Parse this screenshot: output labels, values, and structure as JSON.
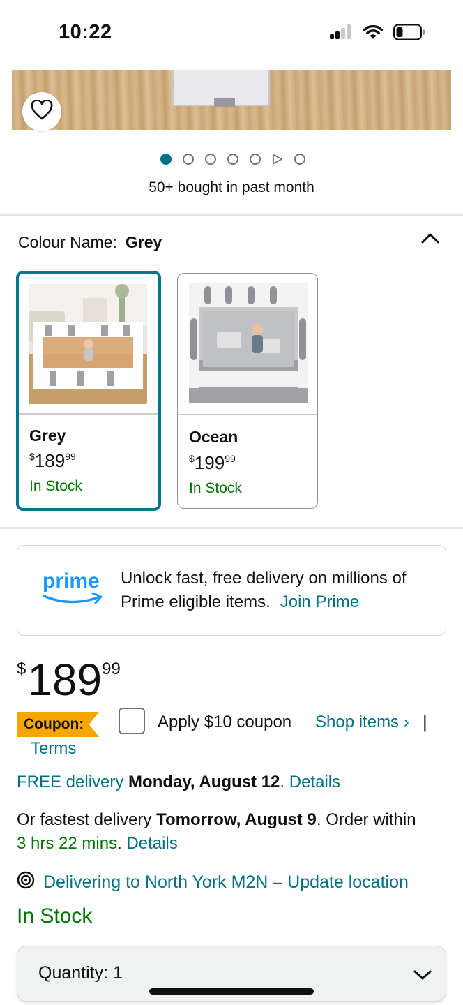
{
  "status_bar": {
    "time": "10:22",
    "icons": [
      "cellular-signal-icon",
      "wifi-icon",
      "battery-icon"
    ]
  },
  "gallery": {
    "image_count": 7,
    "active_index": 0,
    "video_index": 5,
    "bought_text": "50+ bought in past month"
  },
  "colour": {
    "label": "Colour Name:",
    "selected": "Grey",
    "options": [
      {
        "name": "Grey",
        "price_whole": "189",
        "price_frac": "99",
        "currency": "$",
        "stock": "In Stock"
      },
      {
        "name": "Ocean",
        "price_whole": "199",
        "price_frac": "99",
        "currency": "$",
        "stock": "In Stock"
      }
    ]
  },
  "prime": {
    "logo_text": "prime",
    "message": "Unlock fast, free delivery on millions of Prime eligible items.",
    "join_label": "Join Prime"
  },
  "price": {
    "currency": "$",
    "whole": "189",
    "fraction": "99"
  },
  "coupon": {
    "badge": "Coupon:",
    "apply_text": "Apply $10 coupon",
    "shop_items": "Shop items ›",
    "separator": "|",
    "terms": "Terms"
  },
  "delivery": {
    "free_label": "FREE delivery",
    "free_date": "Monday, August 12",
    "free_period": ".",
    "details": "Details",
    "fast_prefix": "Or fastest delivery",
    "fast_date": "Tomorrow, August 9",
    "fast_suffix": ". Order within",
    "countdown": "3 hrs 22 mins",
    "countdown_period": ".",
    "location": "Delivering to North York M2N – Update location"
  },
  "availability": "In Stock",
  "quantity": {
    "label": "Quantity:",
    "value": "1"
  },
  "colors": {
    "link": "#007185",
    "stock_green": "#007600",
    "selected_border": "#00768b",
    "coupon_orange": "#f7a600",
    "prime_blue": "#1a98ff"
  }
}
